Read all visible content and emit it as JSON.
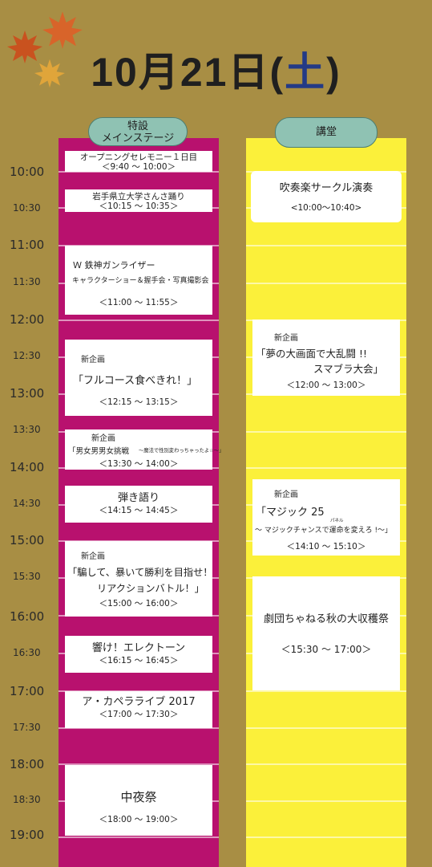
{
  "header": {
    "date_main": "10月21日(",
    "date_day": "土",
    "date_close": ")"
  },
  "columns": {
    "main_stage_line1": "特設",
    "main_stage_line2": "メインステージ",
    "hall": "講堂"
  },
  "times_major": [
    "10:00",
    "11:00",
    "12:00",
    "13:00",
    "14:00",
    "15:00",
    "16:00",
    "17:00",
    "18:00",
    "19:00"
  ],
  "times_minor": [
    "10:30",
    "11:30",
    "12:30",
    "13:30",
    "14:30",
    "15:30",
    "16:30",
    "17:30",
    "18:30"
  ],
  "colors": {
    "background": "#a88e44",
    "main_stage_column": "#b8116e",
    "hall_column": "#fbf03a",
    "header_pill": "#8fc2b3",
    "saturday": "#233a86"
  },
  "badge_new": "新企画",
  "main_events": [
    {
      "name": "オープニングセレモニー１日目",
      "time": "＜9:40 ～ 10:00＞"
    },
    {
      "name": "岩手県立大学さんさ踊り",
      "time": "＜10:15 ～ 10:35＞"
    },
    {
      "name": "Ｗ 鉄神ガンライザー",
      "sub": "キャラクターショー＆握手会・写真撮影会",
      "time": "＜11:00 ～ 11:55＞"
    },
    {
      "name": "「フルコース食べきれ！」",
      "time": "＜12:15 ～ 13:15＞"
    },
    {
      "name": "「男女男男女挑戦",
      "sub": "～魔法で性別変わっちゃったよ☆～」",
      "time": "＜13:30 ～ 14:00＞"
    },
    {
      "name": "弾き語り",
      "time": "＜14:15 ～ 14:45＞"
    },
    {
      "name": "「騙して、暴いて勝利を目指せ！",
      "sub": "リアクションバトル！」",
      "time": "＜15:00 ～ 16:00＞"
    },
    {
      "name": "響け！エレクトーン",
      "time": "＜16:15 ～ 16:45＞"
    },
    {
      "name": "ア・カペラライブ 2017",
      "time": "＜17:00 ～ 17:30＞"
    },
    {
      "name": "中夜祭",
      "time": "＜18:00 ～ 19:00＞"
    }
  ],
  "hall_events": [
    {
      "name": "吹奏楽サークル演奏",
      "time": "<10:00～10:40>"
    },
    {
      "name": "「夢の大画面で大乱闘 !!",
      "sub": "スマブラ大会」",
      "time": "＜12:00 ～ 13:00＞"
    },
    {
      "name": "「マジック 25",
      "sub": "～ マジックチャンスで運命を変えろ !～」",
      "ruby": "パネル",
      "time": "＜14:10 ～ 15:10＞"
    },
    {
      "name": "劇団ちゃねる秋の大収穫祭",
      "time": "＜15:30 ～ 17:00＞"
    }
  ]
}
